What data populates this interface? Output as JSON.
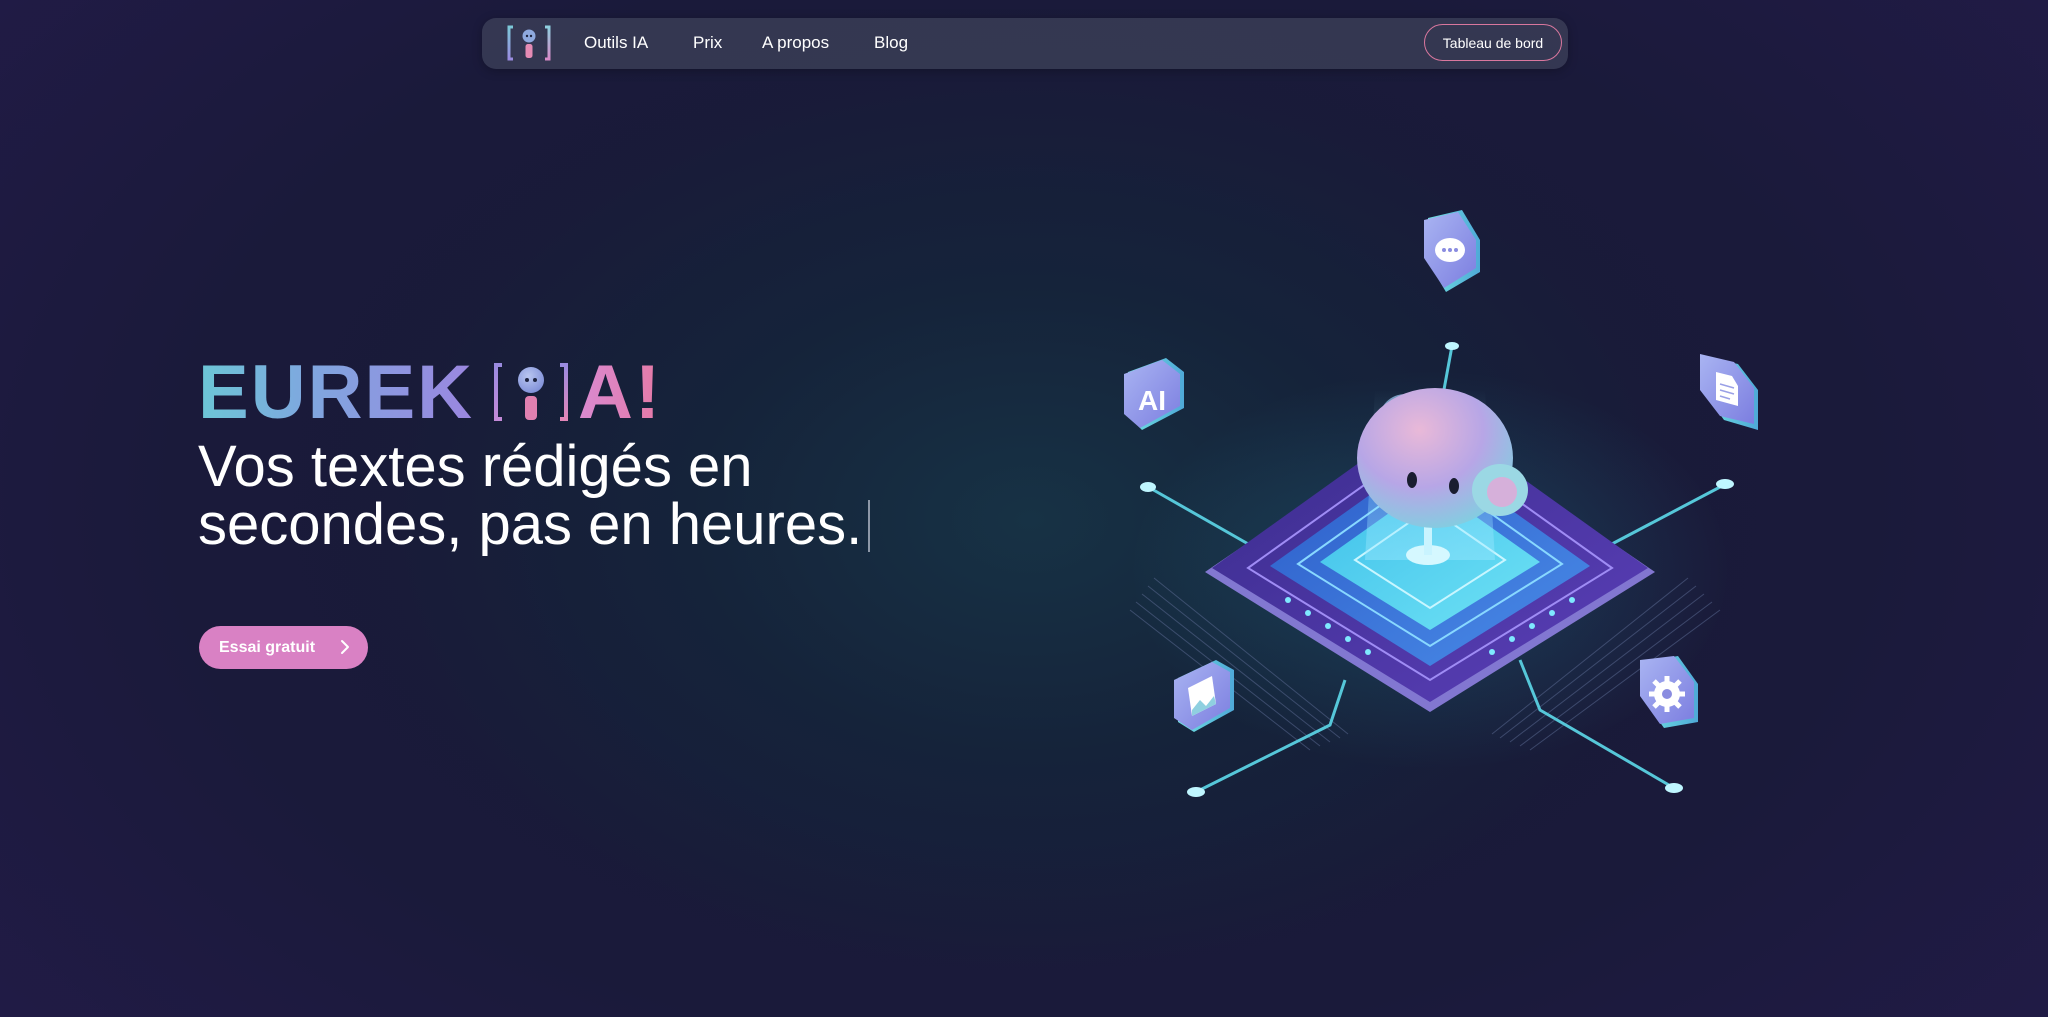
{
  "nav": {
    "links": [
      "Outils IA",
      "Prix",
      "A propos",
      "Blog"
    ],
    "dashboard_label": "Tableau de bord"
  },
  "hero": {
    "brand_left": "EUREK",
    "brand_right": "A!",
    "headline": "Vos textes rédigés en secondes, pas en heures.",
    "cta_label": "Essai gratuit"
  },
  "illustration": {
    "badges": [
      "AI"
    ],
    "icons": [
      "chat-bubble-icon",
      "document-icon",
      "ai-badge-icon",
      "image-icon",
      "gear-icon",
      "robot-mascot-icon",
      "chip-platform-icon"
    ]
  },
  "colors": {
    "accent_pink": "#d981c4",
    "button_border": "#d9779e",
    "gradient_teal": "#6cc6d6",
    "gradient_violet": "#9b86e0",
    "background": "#1b1b3c"
  }
}
